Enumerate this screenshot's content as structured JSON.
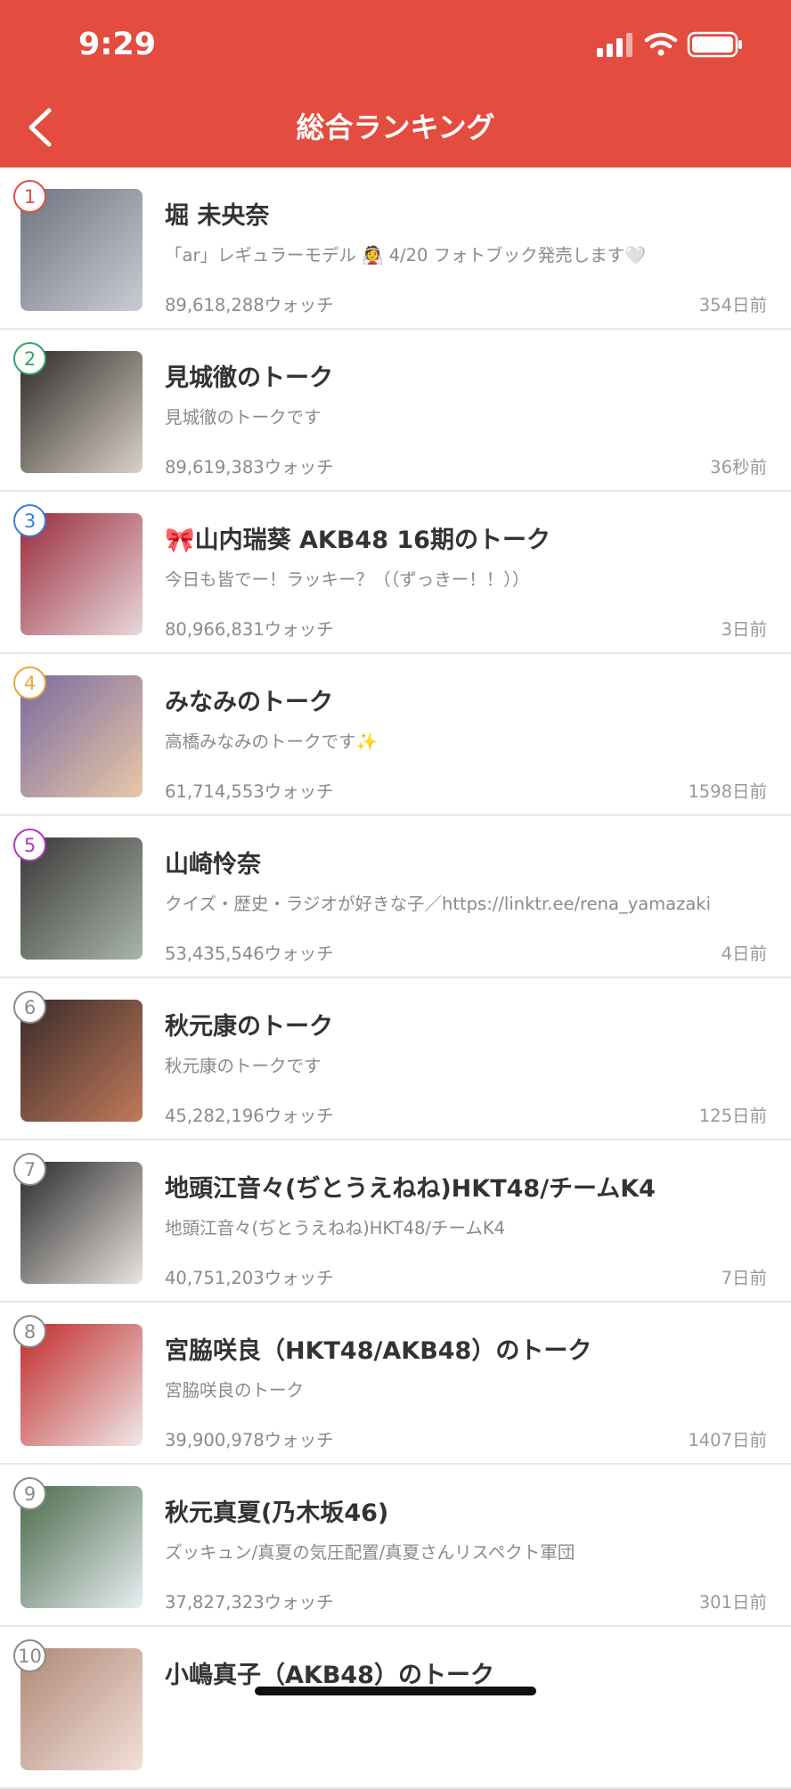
{
  "status_bar": {
    "time": "9:29"
  },
  "header": {
    "title": "総合ランキング"
  },
  "items": [
    {
      "rank": "1",
      "rank_color": "#e34c3f",
      "title": "堀 未央奈",
      "desc": "「ar」レギュラーモデル 👰 4/20 フォトブック発売します🤍",
      "watch": "89,618,288ウォッチ",
      "time": "354日前",
      "thumb_colors": [
        "#6f7380",
        "#c9ccd2"
      ]
    },
    {
      "rank": "2",
      "rank_color": "#2fa66a",
      "title": "見城徹のトーク",
      "desc": "見城徹のトークです",
      "watch": "89,619,383ウォッチ",
      "time": "36秒前",
      "thumb_colors": [
        "#2e2a28",
        "#d9d2c6"
      ]
    },
    {
      "rank": "3",
      "rank_color": "#3a7bd5",
      "title": "🎀山内瑞葵 AKB48 16期のトーク",
      "desc": "今日も皆でー！ラッキー？（（ずっきー！！））",
      "watch": "80,966,831ウォッチ",
      "time": "3日前",
      "thumb_colors": [
        "#9a2a3a",
        "#e8d8dc"
      ]
    },
    {
      "rank": "4",
      "rank_color": "#e8a83a",
      "title": "みなみのトーク",
      "desc": "高橋みなみのトークです✨",
      "watch": "61,714,553ウォッチ",
      "time": "1598日前",
      "thumb_colors": [
        "#7a6aa0",
        "#e8c8a8"
      ]
    },
    {
      "rank": "5",
      "rank_color": "#b23ab8",
      "title": "山崎怜奈",
      "desc": "クイズ・歴史・ラジオが好きな子／https://linktr.ee/rena_yamazaki",
      "watch": "53,435,546ウォッチ",
      "time": "4日前",
      "thumb_colors": [
        "#3a3838",
        "#a9b5a8"
      ]
    },
    {
      "rank": "6",
      "rank_color": "#8a8a8a",
      "title": "秋元康のトーク",
      "desc": "秋元康のトークです",
      "watch": "45,282,196ウォッチ",
      "time": "125日前",
      "thumb_colors": [
        "#3a2a2a",
        "#c07a5a"
      ]
    },
    {
      "rank": "7",
      "rank_color": "#8a8a8a",
      "title": "地頭江音々(ぢとうえねね)HKT48/チームK4",
      "desc": "地頭江音々(ぢとうえねね)HKT48/チームK4",
      "watch": "40,751,203ウォッチ",
      "time": "7日前",
      "thumb_colors": [
        "#2a2a2a",
        "#e9e4e0"
      ]
    },
    {
      "rank": "8",
      "rank_color": "#8a8a8a",
      "title": "宮脇咲良（HKT48/AKB48）のトーク",
      "desc": "宮脇咲良のトーク",
      "watch": "39,900,978ウォッチ",
      "time": "1407日前",
      "thumb_colors": [
        "#c22a2a",
        "#efe8e8"
      ]
    },
    {
      "rank": "9",
      "rank_color": "#8a8a8a",
      "title": "秋元真夏(乃木坂46)",
      "desc": "ズッキュン/真夏の気圧配置/真夏さんリスペクト軍団",
      "watch": "37,827,323ウォッチ",
      "time": "301日前",
      "thumb_colors": [
        "#4a6a4a",
        "#e8eef2"
      ]
    },
    {
      "rank": "10",
      "rank_color": "#8a8a8a",
      "title": "小嶋真子（AKB48）のトーク",
      "desc": "",
      "watch": "",
      "time": "",
      "thumb_colors": [
        "#b08878",
        "#f2e0d8"
      ]
    }
  ]
}
